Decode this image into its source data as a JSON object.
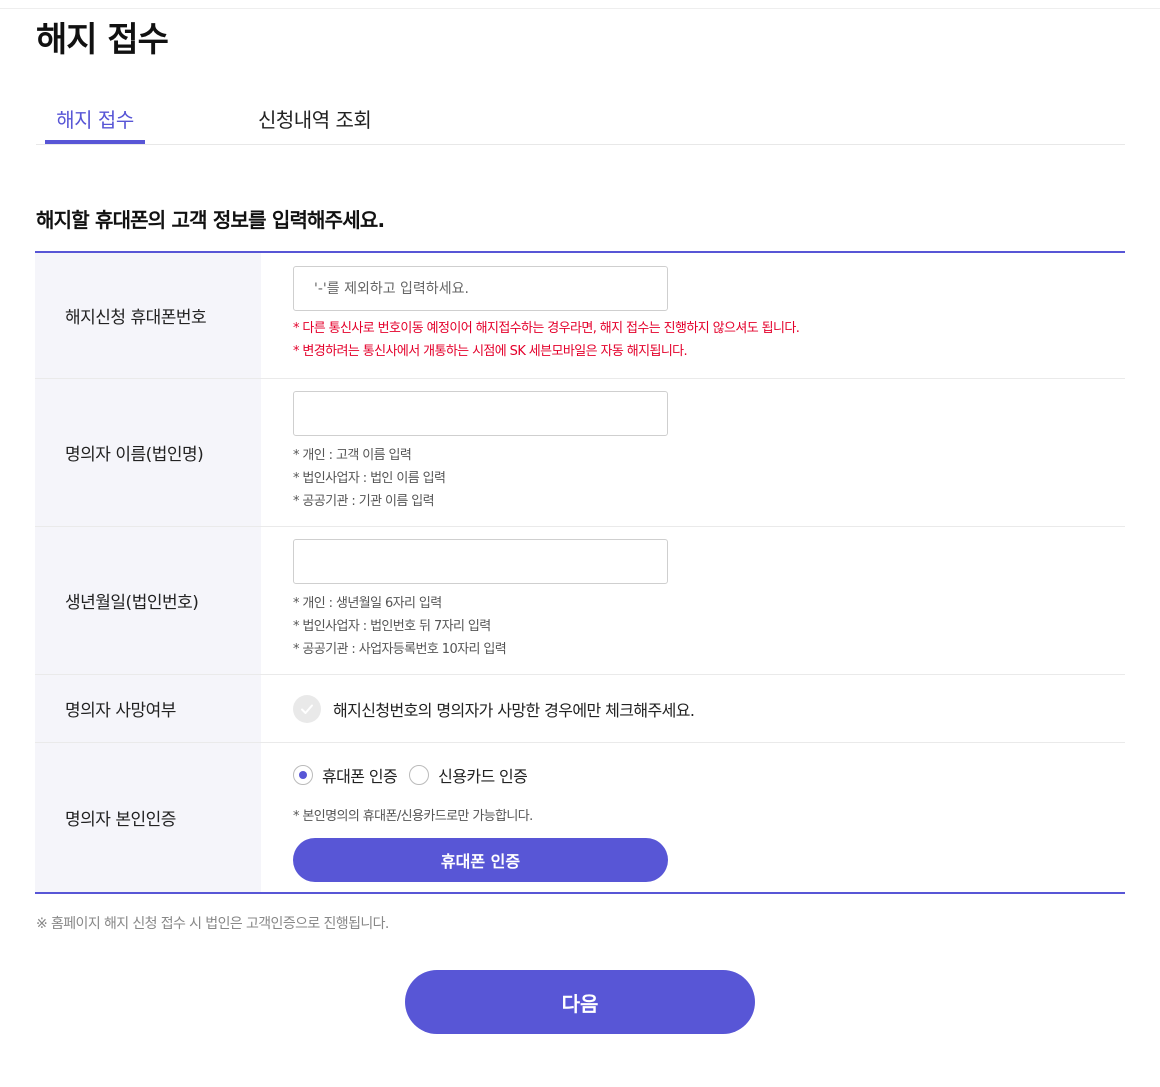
{
  "page": {
    "title": "해지 접수"
  },
  "tabs": [
    {
      "label": "해지 접수",
      "active": true
    },
    {
      "label": "신청내역 조회",
      "active": false
    }
  ],
  "section": {
    "title": "해지할 휴대폰의 고객 정보를 입력해주세요."
  },
  "form": {
    "phone": {
      "label": "해지신청 휴대폰번호",
      "placeholder": "'-'를 제외하고 입력하세요.",
      "value": "",
      "notes": [
        "* 다른 통신사로 번호이동 예정이어 해지접수하는 경우라면, 해지 접수는 진행하지 않으셔도 됩니다.",
        "* 변경하려는 통신사에서 개통하는 시점에 SK 세븐모바일은 자동 해지됩니다."
      ]
    },
    "name": {
      "label": "명의자 이름(법인명)",
      "value": "",
      "notes": [
        "* 개인 : 고객 이름 입력",
        "* 법인사업자 : 법인 이름 입력",
        "* 공공기관 : 기관 이름 입력"
      ]
    },
    "birth": {
      "label": "생년월일(법인번호)",
      "value": "",
      "notes": [
        "* 개인 : 생년월일 6자리 입력",
        "* 법인사업자 : 법인번호 뒤 7자리 입력",
        "* 공공기관 : 사업자등록번호 10자리 입력"
      ]
    },
    "deceased": {
      "label": "명의자 사망여부",
      "checkbox_label": "해지신청번호의 명의자가 사망한 경우에만 체크해주세요.",
      "checked": false
    },
    "auth": {
      "label": "명의자 본인인증",
      "options": [
        {
          "label": "휴대폰 인증",
          "selected": true
        },
        {
          "label": "신용카드 인증",
          "selected": false
        }
      ],
      "note": "* 본인명의의 휴대폰/신용카드로만 가능합니다.",
      "button_label": "휴대폰 인증"
    }
  },
  "footnote": "※ 홈페이지 해지 신청 접수 시 법인은 고객인증으로 진행됩니다.",
  "next_button": "다음",
  "colors": {
    "accent": "#5856d6",
    "warning": "#e4002b",
    "label_bg": "#f5f5fa"
  }
}
